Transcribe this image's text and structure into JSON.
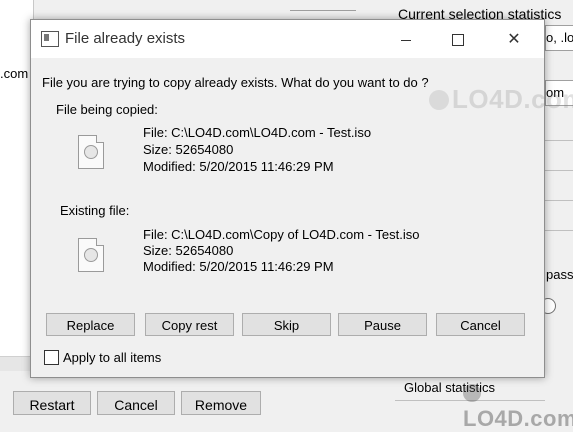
{
  "background": {
    "left_text": ".com",
    "stats_title": "Current selection statistics",
    "field1_value": "o, .lo",
    "field2_value": "om",
    "pass_label": "pass:",
    "global_label": "Global statistics",
    "buttons": [
      {
        "label": "Restart"
      },
      {
        "label": "Cancel"
      },
      {
        "label": "Remove"
      }
    ]
  },
  "dialog": {
    "title": "File already exists",
    "question": "File you are trying to copy already exists. What do you want to do ?",
    "source": {
      "label": "File being copied:",
      "file": "File: C:\\LO4D.com\\LO4D.com - Test.iso",
      "size": "Size: 52654080",
      "modified": "Modified: 5/20/2015 11:46:29 PM"
    },
    "existing": {
      "label": "Existing file:",
      "file": "File: C:\\LO4D.com\\Copy of LO4D.com - Test.iso",
      "size": "Size: 52654080",
      "modified": "Modified: 5/20/2015 11:46:29 PM"
    },
    "buttons": {
      "replace": "Replace",
      "copy_rest": "Copy rest",
      "skip": "Skip",
      "pause": "Pause",
      "cancel": "Cancel"
    },
    "apply_all": {
      "label": "Apply to all items",
      "checked": false
    },
    "titlebar": {
      "minimize_icon": "minimize-icon",
      "maximize_icon": "maximize-icon",
      "close_icon": "close-icon",
      "close_glyph": "✕"
    }
  },
  "watermark": {
    "text": "LO4D.com"
  }
}
